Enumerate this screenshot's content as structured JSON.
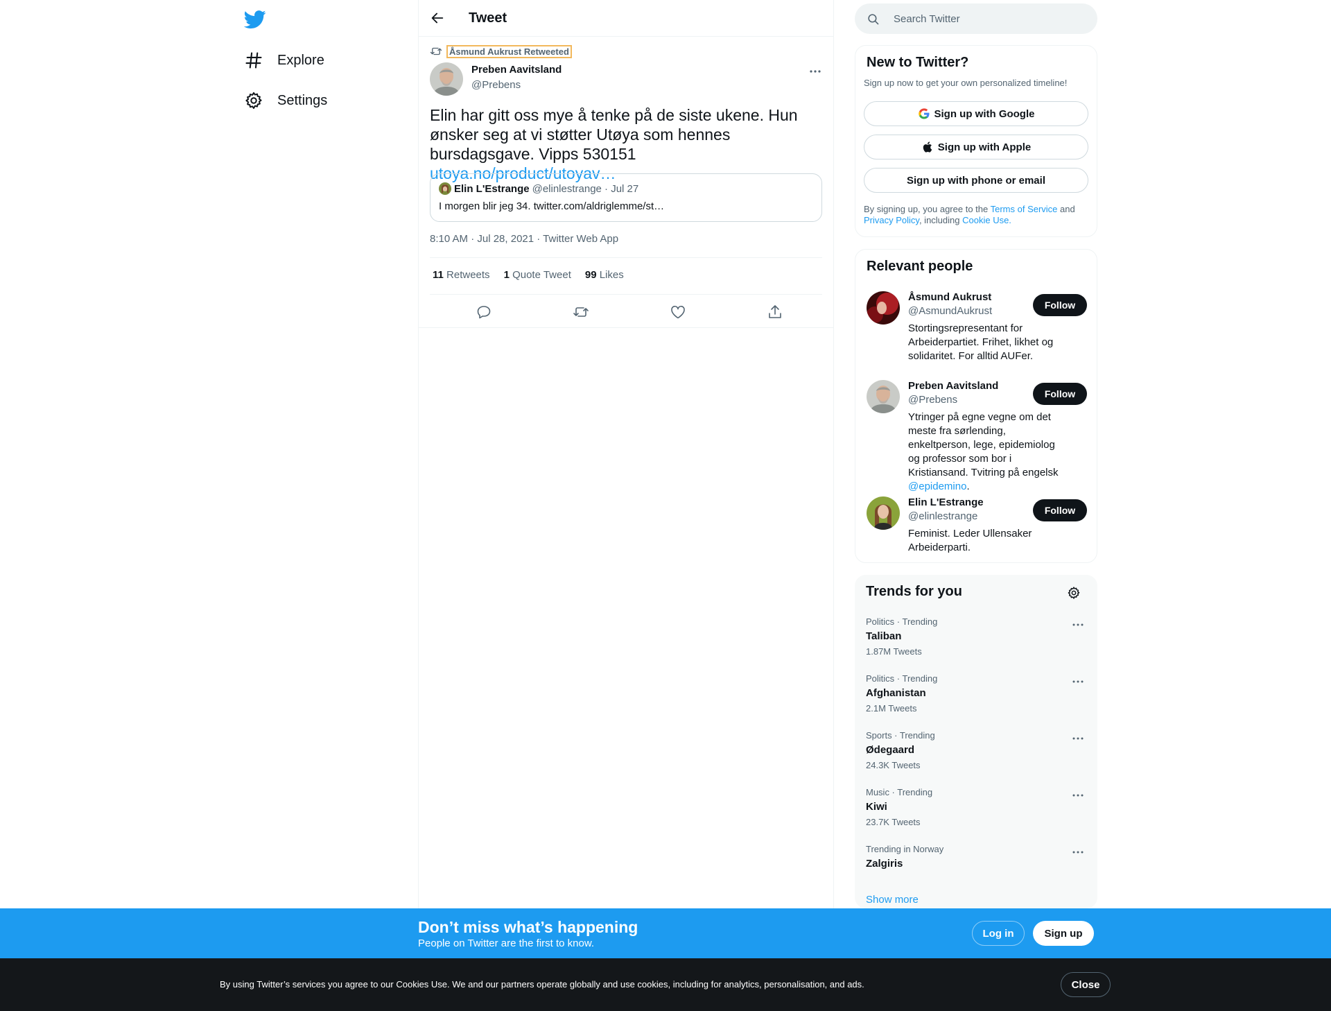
{
  "nav": {
    "items": [
      {
        "label": "Explore",
        "icon": "hashtag-icon"
      },
      {
        "label": "Settings",
        "icon": "gear-icon"
      }
    ]
  },
  "header": {
    "title": "Tweet"
  },
  "tweet": {
    "retweeted_by": "Åsmund Aukrust Retweeted",
    "author_name": "Preben Aavitsland",
    "author_handle": "@Prebens",
    "text": "Elin har gitt oss mye å tenke på de siste ukene. Hun ønsker seg at vi støtter Utøya som hennes bursdagsgave. Vipps 530151 ",
    "link": "utoya.no/product/utoyav…",
    "quote": {
      "name": "Elin L'Estrange",
      "meta": "@elinlestrange · Jul 27",
      "text": "I morgen blir jeg 34. twitter.com/aldriglemme/st…"
    },
    "timestamp": "8:10 AM · Jul 28, 2021 · Twitter Web App",
    "stats": [
      {
        "count": "11",
        "label": "Retweets"
      },
      {
        "count": "1",
        "label": "Quote Tweet"
      },
      {
        "count": "99",
        "label": "Likes"
      }
    ]
  },
  "search": {
    "placeholder": "Search Twitter"
  },
  "signup_card": {
    "title": "New to Twitter?",
    "subtitle": "Sign up now to get your own personalized timeline!",
    "google": "Sign up with Google",
    "apple": "Sign up with Apple",
    "phone": "Sign up with phone or email",
    "legal_1": "By signing up, you agree to the ",
    "terms": "Terms of Service",
    "legal_2": " and ",
    "privacy": "Privacy Policy",
    "legal_3": ", including ",
    "cookie": "Cookie Use."
  },
  "relevant": {
    "title": "Relevant people",
    "follow_label": "Follow",
    "people": [
      {
        "name": "Åsmund Aukrust",
        "handle": "@AsmundAukrust",
        "bio": "Stortingsrepresentant for Arbeiderpartiet. Frihet, likhet og solidaritet. For alltid AUFer."
      },
      {
        "name": "Preben Aavitsland",
        "handle": "@Prebens",
        "bio": "Ytringer på egne vegne om det meste fra sørlending, enkeltperson, lege, epidemiolog og professor som bor i Kristiansand. Tvitring på engelsk ",
        "bio_link": "@epidemino",
        "bio_end": "."
      },
      {
        "name": "Elin L'Estrange",
        "handle": "@elinlestrange",
        "bio": "Feminist. Leder Ullensaker Arbeiderparti."
      }
    ]
  },
  "trends": {
    "title": "Trends for you",
    "items": [
      {
        "meta": "Politics · Trending",
        "name": "Taliban",
        "count": "1.87M Tweets"
      },
      {
        "meta": "Politics · Trending",
        "name": "Afghanistan",
        "count": "2.1M Tweets"
      },
      {
        "meta": "Sports · Trending",
        "name": "Ødegaard",
        "count": "24.3K Tweets"
      },
      {
        "meta": "Music · Trending",
        "name": "Kiwi",
        "count": "23.7K Tweets"
      },
      {
        "meta": "Trending in Norway",
        "name": "Zalgiris",
        "count": ""
      }
    ],
    "show_more": "Show more"
  },
  "login_bar": {
    "title": "Don’t miss what’s happening",
    "subtitle": "People on Twitter are the first to know.",
    "login": "Log in",
    "signup": "Sign up"
  },
  "cookie_bar": {
    "text": "By using Twitter’s services you agree to our Cookies Use. We and our partners operate globally and use cookies, including for analytics, personalisation, and ads.",
    "close": "Close"
  },
  "colors": {
    "accent": "#1d9bf0",
    "text": "#0f1419",
    "muted": "#536471"
  }
}
